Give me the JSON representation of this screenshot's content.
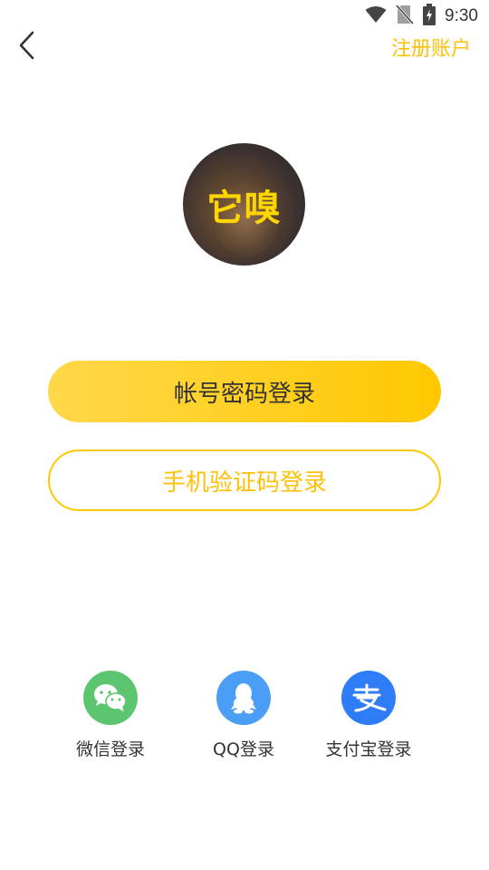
{
  "status_bar": {
    "time": "9:30",
    "icons": [
      "wifi-icon",
      "no-sim-icon",
      "battery-charging-icon"
    ]
  },
  "header": {
    "back_icon": "chevron-left-icon",
    "register_label": "注册账户"
  },
  "logo": {
    "text": "它嗅"
  },
  "actions": {
    "password_login_label": "帐号密码登录",
    "sms_login_label": "手机验证码登录"
  },
  "social": [
    {
      "label": "微信登录",
      "icon": "wechat-icon",
      "color": "#5BC66F"
    },
    {
      "label": "QQ登录",
      "icon": "qq-icon",
      "color": "#4B9EF5"
    },
    {
      "label": "支付宝登录",
      "icon": "alipay-icon",
      "color": "#2E7CF6"
    }
  ],
  "colors": {
    "accent": "#FFC800",
    "accent_text": "#FFC107",
    "text_primary": "#333333"
  }
}
